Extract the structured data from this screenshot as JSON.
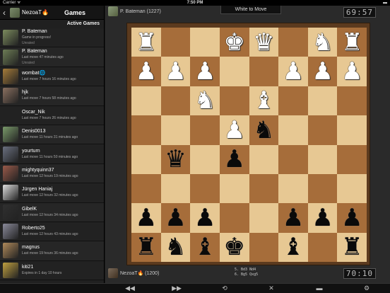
{
  "status_bar": {
    "carrier": "Carrier ᯤ",
    "time": "7:50 PM",
    "battery": "▬"
  },
  "sidebar": {
    "back_icon": "chevron-left-icon",
    "me": "NezoaT🔥",
    "title": "Games",
    "section_label": "Active Games",
    "games": [
      {
        "name": "P. Bateman",
        "line1": "Game in progress!",
        "line2": "Unrated",
        "color": "#7c8c5e"
      },
      {
        "name": "P. Bateman",
        "line1": "Last move 47 minutes ago",
        "line2": "Unrated",
        "color": "#6d7d55"
      },
      {
        "name": "wombat🌐",
        "line1": "Last move 7 hours 16 minutes ago",
        "line2": "",
        "color": "#a67c3a"
      },
      {
        "name": "hjk",
        "line1": "Last move 7 hours 58 minutes ago",
        "line2": "",
        "color": "#8a7060"
      },
      {
        "name": "Oscar_Nik",
        "line1": "Last move 7 hours 26 minutes ago",
        "line2": "",
        "color": "#222222"
      },
      {
        "name": "Denis0013",
        "line1": "Last move 11 hours 31 minutes ago",
        "line2": "",
        "color": "#7a9a6a"
      },
      {
        "name": "yourturn",
        "line1": "Last move 11 hours 50 minutes ago",
        "line2": "",
        "color": "#6a7080"
      },
      {
        "name": "mightyquinn37",
        "line1": "Last move 12 hours 19 minutes ago",
        "line2": "",
        "color": "#9a5a4a"
      },
      {
        "name": "Jürgen Haniaj",
        "line1": "Last move 12 hours 32 minutes ago",
        "line2": "",
        "color": "#dddddd"
      },
      {
        "name": "GibelK",
        "line1": "Last move 12 hours 34 minutes ago",
        "line2": "",
        "color": "#303030"
      },
      {
        "name": "Roberto25",
        "line1": "Last move 12 hours 43 minutes ago",
        "line2": "",
        "color": "#8a8a9a"
      },
      {
        "name": "magnus",
        "line1": "Last move 19 hours 36 minutes ago",
        "line2": "",
        "color": "#b08a5a"
      },
      {
        "name": "kiti21",
        "line1": "Expires in 1 day 10 hours",
        "line2": "",
        "color": "#c0a040"
      }
    ]
  },
  "main": {
    "top_player": "P. Bateman (1227)",
    "status": "White to Move",
    "top_clock": "69:57",
    "bottom_player": "NezoaT🔥 (1200)",
    "bottom_clock": "70:10",
    "moves": [
      "5.  Bd3  Nd4",
      "6.  Bg5  Qxg5"
    ]
  },
  "board": [
    [
      "♜",
      "",
      "",
      "♚",
      "♛",
      "",
      "♞",
      "♜"
    ],
    [
      "♟",
      "♟",
      "♟",
      "",
      "",
      "♟",
      "♟",
      "♟"
    ],
    [
      "",
      "",
      "♞",
      "",
      "♝",
      "",
      "",
      ""
    ],
    [
      "",
      "",
      "",
      "♟",
      "♞",
      "",
      "",
      ""
    ],
    [
      "",
      "♛",
      "",
      "♟",
      "",
      "",
      "",
      ""
    ],
    [
      "",
      "",
      "",
      "",
      "",
      "",
      "",
      ""
    ],
    [
      "♟",
      "♟",
      "♟",
      "",
      "",
      "♟",
      "♟",
      "♟"
    ],
    [
      "♜",
      "♞",
      "♝",
      "♚",
      "",
      "♝",
      "",
      "♜"
    ]
  ],
  "board_colors": [
    [
      "w",
      "",
      "",
      "w",
      "w",
      "",
      "w",
      "w"
    ],
    [
      "w",
      "w",
      "w",
      "",
      "",
      "w",
      "w",
      "w"
    ],
    [
      "",
      "",
      "w",
      "",
      "w",
      "",
      "",
      ""
    ],
    [
      "",
      "",
      "",
      "w",
      "b",
      "",
      "",
      ""
    ],
    [
      "",
      "b",
      "",
      "b",
      "",
      "",
      "",
      ""
    ],
    [
      "",
      "",
      "",
      "",
      "",
      "",
      "",
      ""
    ],
    [
      "b",
      "b",
      "b",
      "",
      "",
      "b",
      "b",
      "b"
    ],
    [
      "b",
      "b",
      "b",
      "b",
      "",
      "b",
      "",
      "b"
    ]
  ],
  "toolbar": {
    "icons": [
      "rewind-icon",
      "forward-icon",
      "refresh-icon",
      "resign-icon",
      "chat-icon",
      "gear-icon"
    ],
    "glyphs": [
      "◀◀",
      "▶▶",
      "⟲",
      "✕",
      "▬",
      "⚙"
    ]
  }
}
